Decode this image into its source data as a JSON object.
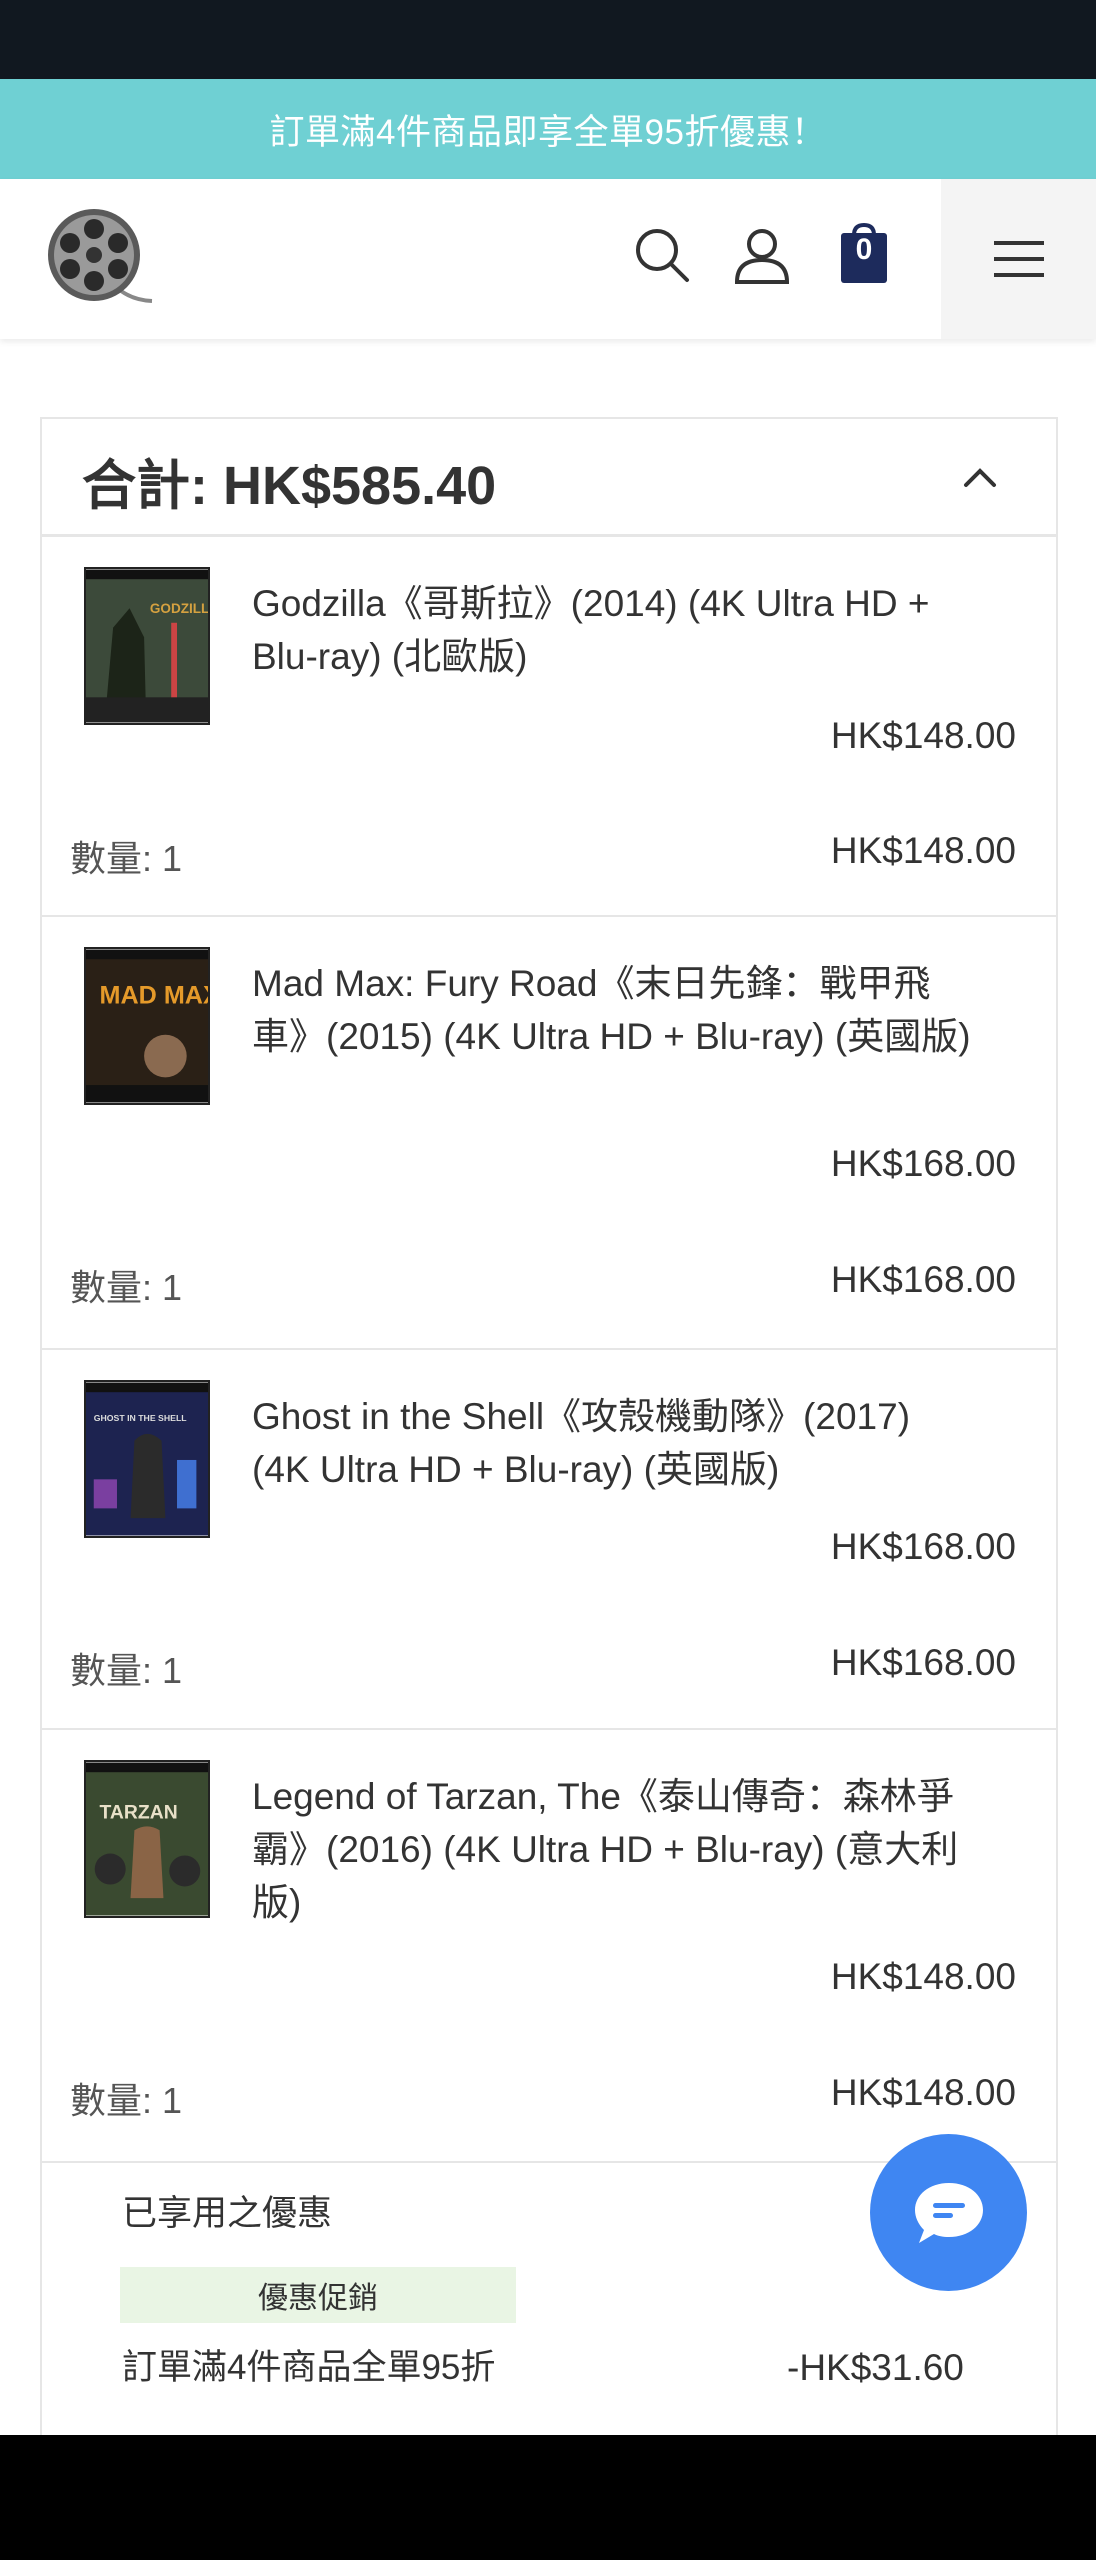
{
  "promo_banner": {
    "text": "訂單滿4件商品即享全單95折優惠！"
  },
  "header": {
    "cart_count": "0"
  },
  "summary": {
    "total_label": "合計: HK$585.40",
    "items": [
      {
        "title": "Godzilla《哥斯拉》(2014) (4K Ultra HD + Blu-ray) (北歐版)",
        "cover_text": "GODZILLA",
        "unit_price": "HK$148.00",
        "quantity": "數量: 1",
        "line_total": "HK$148.00"
      },
      {
        "title": "Mad Max: Fury Road《末日先鋒：戰甲飛車》(2015) (4K Ultra HD + Blu-ray) (英國版)",
        "cover_text": "MAD MAX",
        "unit_price": "HK$168.00",
        "quantity": "數量: 1",
        "line_total": "HK$168.00"
      },
      {
        "title": "Ghost in the Shell《攻殼機動隊》(2017) (4K Ultra HD + Blu-ray) (英國版)",
        "cover_text": "GHOST IN THE SHELL",
        "unit_price": "HK$168.00",
        "quantity": "數量: 1",
        "line_total": "HK$168.00"
      },
      {
        "title": "Legend of Tarzan, The《泰山傳奇：森林爭霸》(2016) (4K Ultra HD + Blu-ray) (意大利版)",
        "cover_text": "TARZAN",
        "unit_price": "HK$148.00",
        "quantity": "數量: 1",
        "line_total": "HK$148.00"
      }
    ],
    "discounts": {
      "title": "已享用之優惠",
      "tag": "優惠促銷",
      "name": "訂單滿4件商品全單95折",
      "amount": "-HK$31.60"
    }
  },
  "colors": {
    "promo_bg": "#6fd0d3",
    "chat_button": "#3f86f2",
    "cart_icon": "#1d2b5c",
    "discount_tag_bg": "#e9f5e4"
  }
}
